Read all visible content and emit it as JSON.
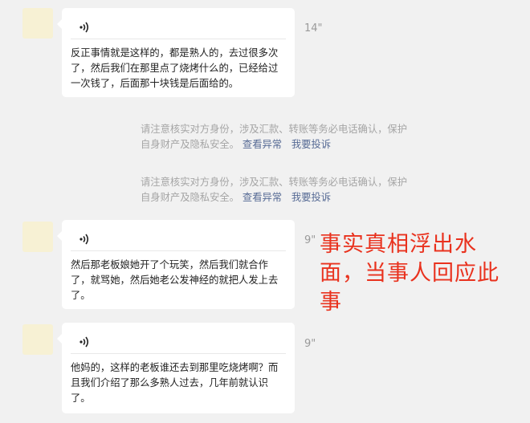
{
  "messages": [
    {
      "duration": "14\"",
      "text": "反正事情就是这样的，都是熟人的，去过很多次了，然后我们在那里点了烧烤什么的，已经给过一次钱了，后面那十块钱是后面给的。"
    },
    {
      "duration": "9\"",
      "text": "然后那老板娘她开了个玩笑，然后我们就合作了，就骂她，然后她老公发神经的就把人发上去了。"
    },
    {
      "duration": "9\"",
      "text": "他妈的，这样的老板谁还去到那里吃烧烤啊？而且我们介绍了那么多熟人过去，几年前就认识了。"
    }
  ],
  "system_notices": [
    {
      "text": "请注意核实对方身份，涉及汇款、转账等务必电话确认，保护自身财产及隐私安全。",
      "link_report_abnormal": "查看异常",
      "link_complain": "我要投诉"
    },
    {
      "text": "请注意核实对方身份，涉及汇款、转账等务必电话确认，保护自身财产及隐私安全。",
      "link_report_abnormal": "查看异常",
      "link_complain": "我要投诉"
    }
  ],
  "caption": "事实真相浮出水面，当事人回应此事",
  "icons": {
    "voice": "voice-message-icon"
  },
  "colors": {
    "caption": "#e9321e",
    "link": "#576b95",
    "notice": "#a5a5a5",
    "background": "#f1f1f1"
  }
}
